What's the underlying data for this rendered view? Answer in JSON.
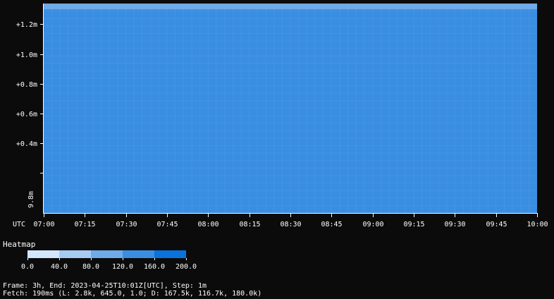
{
  "chart_data": {
    "type": "heatmap",
    "x_axis": {
      "timezone_label": "UTC",
      "ticks": [
        "07:00",
        "07:15",
        "07:30",
        "07:45",
        "08:00",
        "08:15",
        "08:30",
        "08:45",
        "09:00",
        "09:15",
        "09:30",
        "09:45",
        "10:00"
      ],
      "range_minutes": [
        0,
        180
      ]
    },
    "y_axis": {
      "ticks": [
        {
          "label": "+1.2m",
          "value": 1.2
        },
        {
          "label": "+1.0m",
          "value": 1.0
        },
        {
          "label": "+0.8m",
          "value": 0.8
        },
        {
          "label": "+0.6m",
          "value": 0.6
        },
        {
          "label": "+0.4m",
          "value": 0.4
        }
      ],
      "base_label": "9.8m",
      "range": [
        -0.07,
        1.34
      ]
    },
    "bands": [
      {
        "from": -0.07,
        "to": 1.3,
        "value": 150
      },
      {
        "from": 1.3,
        "to": 1.34,
        "value": 110
      }
    ],
    "legend": {
      "title": "Heatmap",
      "colors": [
        "#d4e6fb",
        "#a6cbf3",
        "#6faae9",
        "#3a8ee2",
        "#0a72dd"
      ],
      "tick_labels": [
        "0.0",
        "40.0",
        "80.0",
        "120.0",
        "160.0",
        "200.0"
      ],
      "range": [
        0,
        200
      ]
    }
  },
  "footer": {
    "line1": "Frame: 3h, End: 2023-04-25T10:01Z[UTC], Step: 1m",
    "line2": "Fetch: 190ms (L: 2.8k, 645.0, 1.0; D: 167.5k, 116.7k, 180.0k)"
  }
}
